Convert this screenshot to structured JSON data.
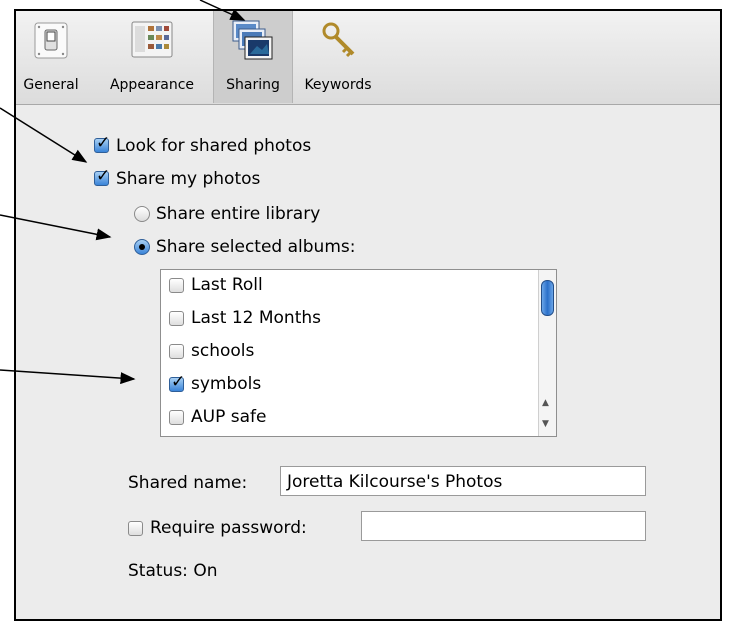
{
  "toolbar": {
    "tabs": [
      {
        "label": "General",
        "icon": "general-switch-icon"
      },
      {
        "label": "Appearance",
        "icon": "appearance-layout-icon"
      },
      {
        "label": "Sharing",
        "icon": "sharing-photos-icon"
      },
      {
        "label": "Keywords",
        "icon": "keywords-key-icon"
      }
    ],
    "selected": "Sharing"
  },
  "sharing": {
    "look_for_shared": {
      "label": "Look for shared photos",
      "checked": true
    },
    "share_my_photos": {
      "label": "Share my photos",
      "checked": true
    },
    "share_entire": {
      "label": "Share entire library",
      "selected": false
    },
    "share_selected": {
      "label": "Share selected albums:",
      "selected": true
    },
    "albums": [
      {
        "name": "Last Roll",
        "checked": false
      },
      {
        "name": "Last 12 Months",
        "checked": false
      },
      {
        "name": "schools",
        "checked": false
      },
      {
        "name": "symbols",
        "checked": true
      },
      {
        "name": "AUP safe",
        "checked": false
      }
    ],
    "shared_name_label": "Shared name:",
    "shared_name_value": "Joretta Kilcourse's Photos",
    "require_password": {
      "label": "Require password:",
      "checked": false
    },
    "password_value": "",
    "status_label": "Status:",
    "status_value": "On"
  },
  "colors": {
    "accent": "#3a84d8",
    "window_bg": "#ececec"
  }
}
